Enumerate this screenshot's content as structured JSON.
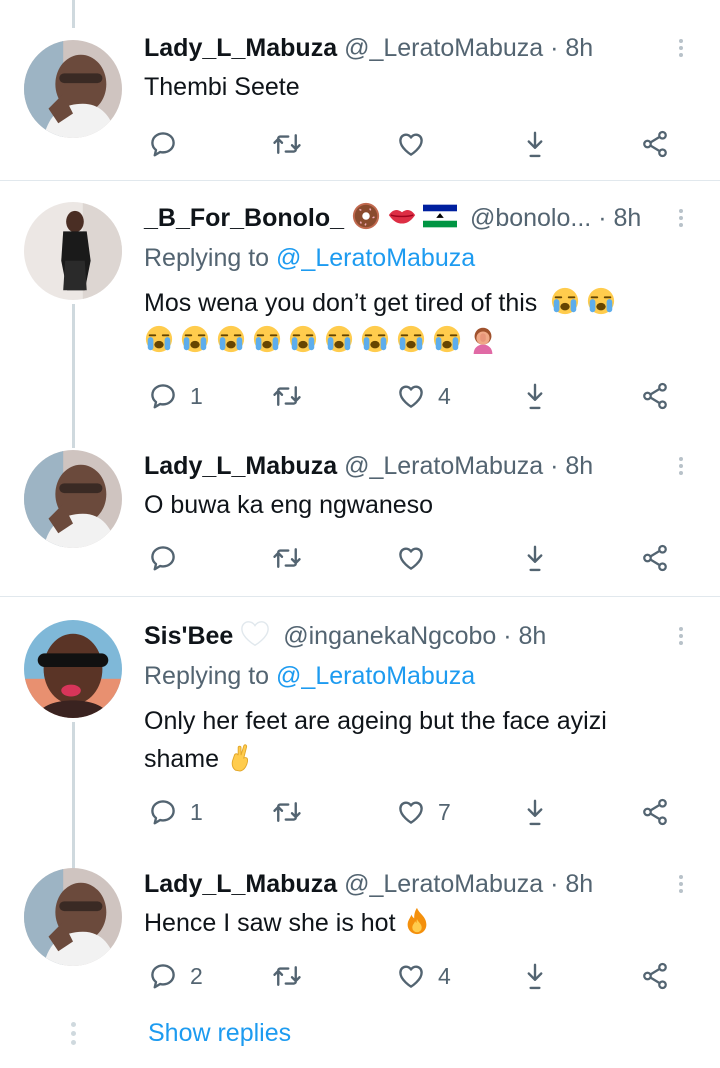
{
  "tweets": [
    {
      "name": "Lady_L_Mabuza",
      "handle": "@_LeratoMabuza",
      "time": "· 8h",
      "text": "Thembi Seete",
      "counts": {
        "reply": "",
        "retweet": "",
        "like": ""
      }
    },
    {
      "name": "_B_For_Bonolo_",
      "name_emojis": [
        "doughnut-emoji",
        "kiss-lips-emoji",
        "lesotho-flag-emoji"
      ],
      "handle": "@bonolo...",
      "time": "· 8h",
      "replying_prefix": "Replying to",
      "replying_to": "@_LeratoMabuza",
      "text": "Mos wena you don’t get tired of this",
      "text_emojis": [
        "crying-face-emoji",
        "crying-face-emoji",
        "crying-face-emoji",
        "crying-face-emoji",
        "crying-face-emoji",
        "crying-face-emoji",
        "crying-face-emoji",
        "crying-face-emoji",
        "crying-face-emoji",
        "crying-face-emoji",
        "crying-face-emoji",
        "woman-facepalming-emoji"
      ],
      "counts": {
        "reply": "1",
        "retweet": "",
        "like": "4"
      }
    },
    {
      "name": "Lady_L_Mabuza",
      "handle": "@_LeratoMabuza",
      "time": "· 8h",
      "text": "O buwa ka eng ngwaneso",
      "counts": {
        "reply": "",
        "retweet": "",
        "like": ""
      }
    },
    {
      "name": "Sis'Bee",
      "name_emojis": [
        "white-heart-emoji"
      ],
      "handle": "@inganekaNgcobo",
      "time": "· 8h",
      "replying_prefix": "Replying to",
      "replying_to": "@_LeratoMabuza",
      "text_line1": "Only her feet are ageing but the face ayizi",
      "text_line2": "shame",
      "text_emojis": [
        "crossed-fingers-emoji"
      ],
      "counts": {
        "reply": "1",
        "retweet": "",
        "like": "7"
      }
    },
    {
      "name": "Lady_L_Mabuza",
      "handle": "@_LeratoMabuza",
      "time": "· 8h",
      "text": "Hence I saw she is hot",
      "text_emojis": [
        "fire-emoji"
      ],
      "counts": {
        "reply": "2",
        "retweet": "",
        "like": "4"
      }
    }
  ],
  "show_replies": "Show replies",
  "colors": {
    "accent": "#1d9bf0",
    "secondary_text": "#536471",
    "divider": "#e1e8ed",
    "thread_line": "#cfd9de"
  },
  "icons": [
    "reply-icon",
    "retweet-icon",
    "like-icon",
    "bookmark-icon",
    "share-icon",
    "more-icon"
  ]
}
